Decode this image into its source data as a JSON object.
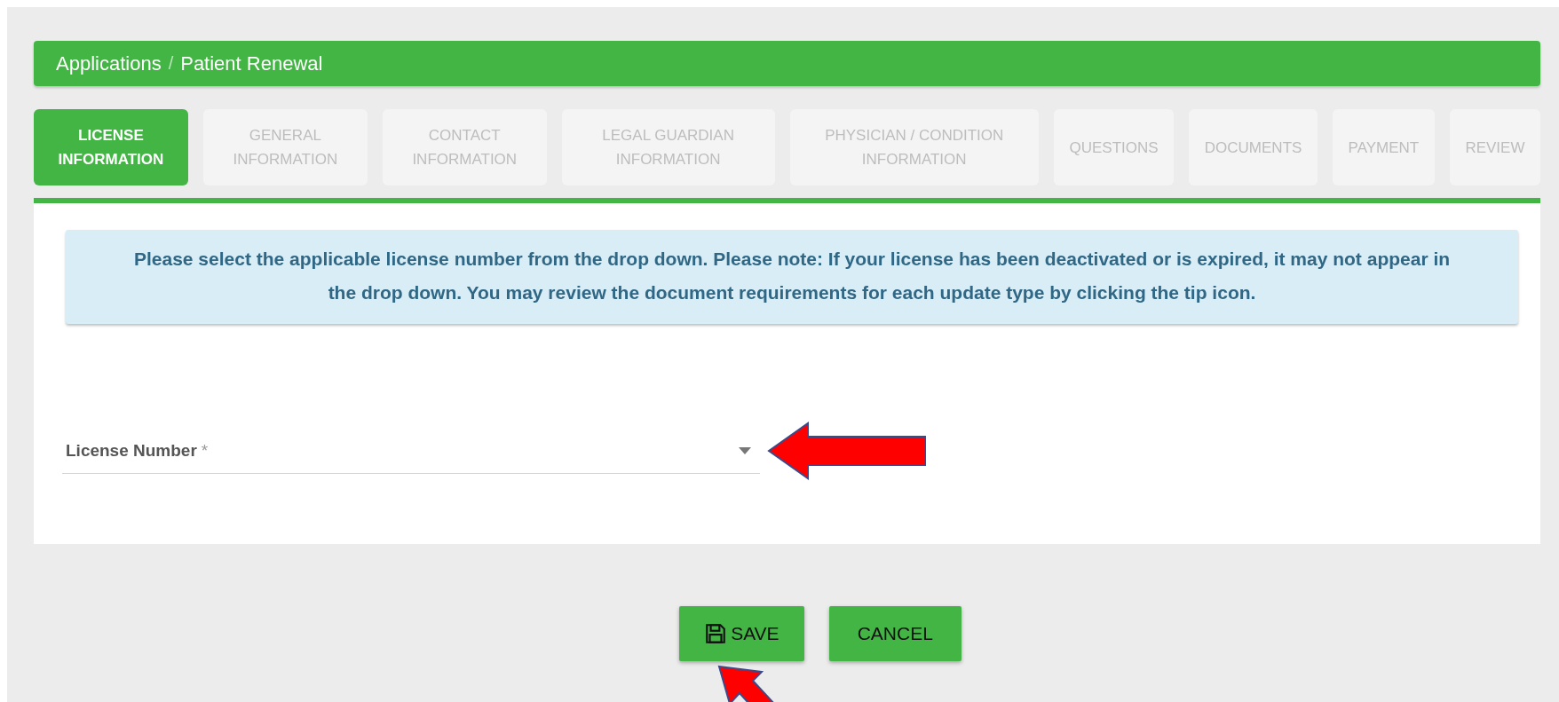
{
  "breadcrumb": [
    {
      "label": "Applications"
    },
    {
      "label": "Patient Renewal"
    }
  ],
  "breadcrumb_separator": "/",
  "steps": [
    {
      "lines": [
        "LICENSE",
        "INFORMATION"
      ],
      "selected": true
    },
    {
      "lines": [
        "GENERAL",
        "INFORMATION"
      ],
      "selected": false
    },
    {
      "lines": [
        "CONTACT",
        "INFORMATION"
      ],
      "selected": false
    },
    {
      "lines": [
        "LEGAL GUARDIAN",
        "INFORMATION"
      ],
      "selected": false
    },
    {
      "lines": [
        "PHYSICIAN / CONDITION",
        "INFORMATION"
      ],
      "selected": false
    },
    {
      "lines": [
        "QUESTIONS"
      ],
      "selected": false
    },
    {
      "lines": [
        "DOCUMENTS"
      ],
      "selected": false
    },
    {
      "lines": [
        "PAYMENT"
      ],
      "selected": false
    },
    {
      "lines": [
        "REVIEW"
      ],
      "selected": false
    }
  ],
  "notice": "Please select the applicable license number from the drop down. Please note: If your license has been deactivated or is expired, it may not appear in the drop down. You may review the document requirements for each update type by clicking the tip icon.",
  "license_field": {
    "label": "License Number",
    "required_mark": "*"
  },
  "buttons": [
    {
      "kind": "save",
      "label": "SAVE"
    },
    {
      "kind": "cancel",
      "label": "CANCEL"
    }
  ]
}
